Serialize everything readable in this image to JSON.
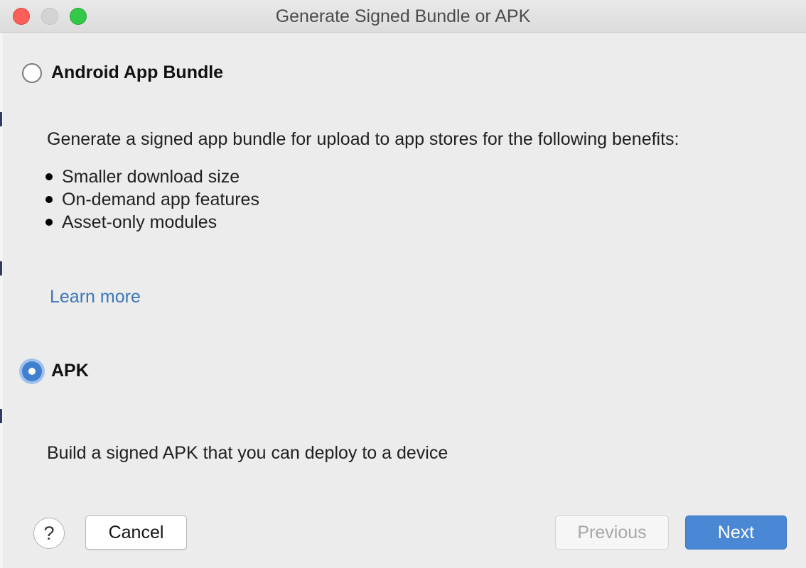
{
  "window": {
    "title": "Generate Signed Bundle or APK"
  },
  "options": {
    "bundle": {
      "label": "Android App Bundle",
      "selected": false,
      "description": "Generate a signed app bundle for upload to app stores for the following benefits:",
      "benefits": [
        "Smaller download size",
        "On-demand app features",
        "Asset-only modules"
      ],
      "learn_more": "Learn more"
    },
    "apk": {
      "label": "APK",
      "selected": true,
      "description": "Build a signed APK that you can deploy to a device"
    }
  },
  "footer": {
    "help_label": "?",
    "cancel_label": "Cancel",
    "previous_label": "Previous",
    "next_label": "Next"
  },
  "colors": {
    "accent": "#4a87d4",
    "link": "#3b76bf",
    "close": "#fc5f57",
    "zoom": "#34c84a"
  },
  "icons": {
    "help": "help-icon",
    "radio_on": "radio-checked-icon",
    "radio_off": "radio-unchecked-icon",
    "bullet": "bullet-icon"
  }
}
